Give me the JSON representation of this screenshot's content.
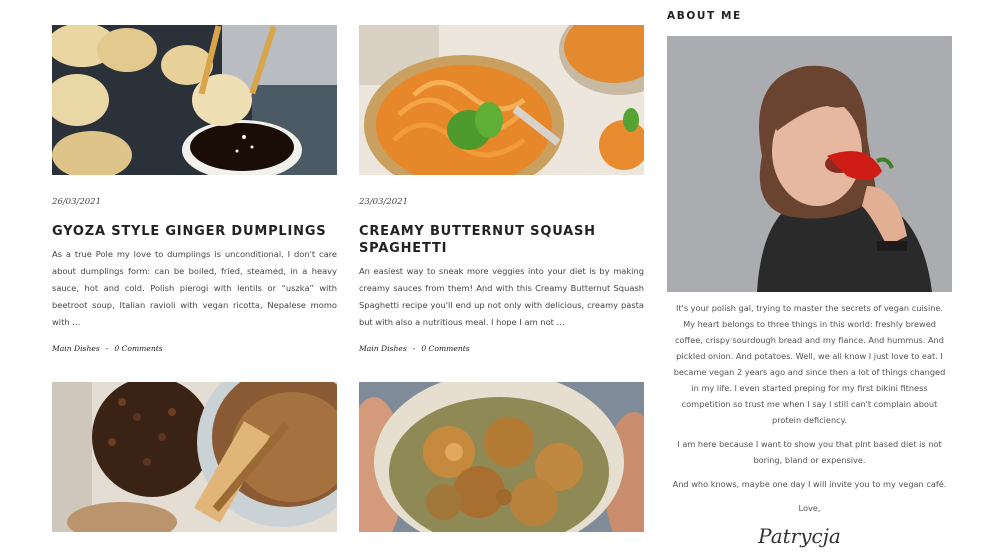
{
  "posts": [
    {
      "date": "26/03/2021",
      "title": "GYOZA STYLE GINGER DUMPLINGS",
      "excerpt": "As a true Pole my love to dumplings is unconditional. I don't care about dumplings form: can be boiled, fried, steamed, in a heavy sauce, hot and cold. Polish pierogi with lentils or “uszka” with beetroot soup, Italian ravioli with vegan ricotta, Nepalese momo with …",
      "category": "Main Dishes",
      "separator": "-",
      "comments": "0 Comments"
    },
    {
      "date": "23/03/2021",
      "title": "CREAMY BUTTERNUT SQUASH SPAGHETTI",
      "excerpt": "An easiest way to sneak more veggies into your diet is by making creamy sauces from them! And with this Creamy Butternut Squash Spaghetti recipe you'll end up not only with delicious, creamy pasta but with also a nutritious meal. I hope I am not …",
      "category": "Main Dishes",
      "separator": "-",
      "comments": "0 Comments"
    }
  ],
  "sidebar": {
    "about_title": "ABOUT ME",
    "paragraphs": [
      "It's your polish gal, trying to master the secrets of vegan cuisine. My heart belongs to three things in this world: freshly brewed coffee, crispy sourdough bread and my fiance. And hummus. And pickled onion. And potatoes. Well, we all know I just love to eat. I became vegan 2 years ago and since then a lot of things changed in my life. I even started preping for my first bikini fitness competition so trust me when I say I still can't complain about protein deficiency.",
      "I am here because I want to show you that plnt based diet is not boring, bland or expensive.",
      "And who knows, maybe one day I will invite you to my vegan café.",
      "Love,"
    ],
    "signature": "Patrycja"
  },
  "colors": {
    "text": "#333333",
    "background": "#ffffff",
    "photo_bg": "#a9acaf"
  }
}
